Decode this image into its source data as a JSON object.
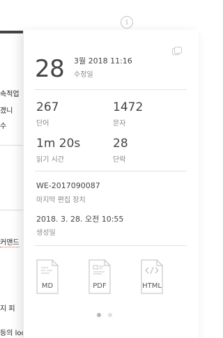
{
  "background_window": {
    "info_icon": "info-icon",
    "fragments": [
      "속적업",
      "겠니",
      "수",
      "커맨드",
      "지 피",
      "등의 lockfile을 기준으로"
    ]
  },
  "panel": {
    "copy_icon": "copy-icon",
    "modified": {
      "day": "28",
      "datetime": "3월 2018 11:16",
      "label": "수정일"
    },
    "stats": [
      {
        "value": "267",
        "label": "단어"
      },
      {
        "value": "1472",
        "label": "문자"
      },
      {
        "value": "1m 20s",
        "label": "읽기 시간"
      },
      {
        "value": "28",
        "label": "단락"
      }
    ],
    "device": {
      "value": "WE-2017090087",
      "label": "마지막 편집 장치"
    },
    "created": {
      "value": "2018. 3. 28. 오전 10:55",
      "label": "생성일"
    },
    "exports": [
      {
        "label": "MD",
        "icon": "md-file-icon"
      },
      {
        "label": "PDF",
        "icon": "pdf-file-icon"
      },
      {
        "label": "HTML",
        "icon": "html-file-icon"
      }
    ],
    "pager": {
      "pages": 2,
      "current": 1
    },
    "colors": {
      "dot_active": "#b5b5b5",
      "dot_inactive": "#e0e0e0"
    }
  }
}
